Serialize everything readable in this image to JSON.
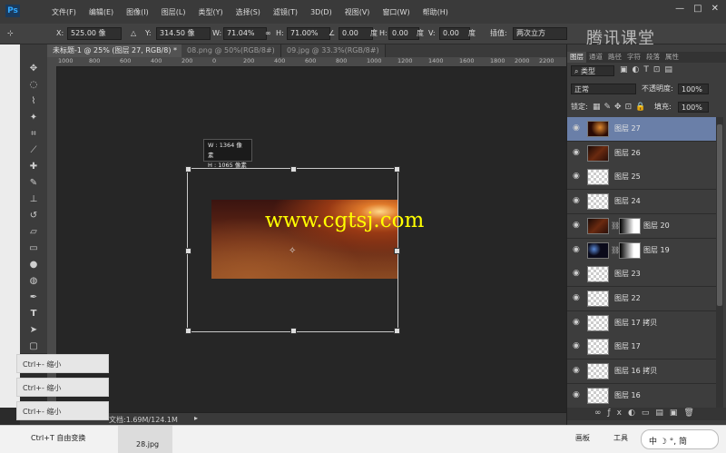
{
  "app": {
    "logo": "Ps"
  },
  "menu": [
    "文件(F)",
    "编辑(E)",
    "图像(I)",
    "图层(L)",
    "类型(Y)",
    "选择(S)",
    "滤镜(T)",
    "3D(D)",
    "视图(V)",
    "窗口(W)",
    "帮助(H)"
  ],
  "window_controls": {
    "minimize": "—",
    "restore": "□",
    "close": "✕"
  },
  "brand": "腾讯课堂",
  "options": {
    "x_label": "X:",
    "x_value": "525.00 像",
    "y_label": "Y:",
    "y_value": "314.50 像",
    "w_label": "W:",
    "w_value": "71.04%",
    "h_label": "H:",
    "h_value": "71.00%",
    "angle_value": "0.00",
    "hskew_label": "H:",
    "hskew_value": "0.00",
    "hskew_unit": "度",
    "vskew_label": "V:",
    "vskew_value": "0.00",
    "vskew_unit": "度",
    "angle_unit": "度",
    "interp_label": "插值:",
    "interp_value": "两次立方"
  },
  "tabs": [
    {
      "label": "未标题-1 @ 25% (图层 27, RGB/8) *",
      "active": true
    },
    {
      "label": "08.png @ 50%(RGB/8#)",
      "active": false
    },
    {
      "label": "09.jpg @ 33.3%(RGB/8#)",
      "active": false
    }
  ],
  "ruler_ticks": [
    "1000",
    "800",
    "600",
    "400",
    "200",
    "0",
    "200",
    "400",
    "600",
    "800",
    "1000",
    "1200",
    "1400",
    "1600",
    "1800",
    "2000",
    "2200"
  ],
  "tooltip": {
    "w": "W : 1364 像素",
    "h": "H : 1065 像素"
  },
  "watermark": "www.cgtsj.com",
  "status": {
    "doc": "文档:1.69M/124.1M"
  },
  "shortcuts": [
    "Ctrl+- 缩小",
    "Ctrl+- 缩小",
    "Ctrl+- 缩小"
  ],
  "taskbar": {
    "free_transform": "Ctrl+T 自由变换",
    "file": "28.jpg",
    "artboard": "画板",
    "tools": "工具",
    "ime": "中 ☽ °, 简"
  },
  "panel": {
    "tabs": [
      "图层",
      "通道",
      "路径",
      "字符",
      "段落",
      "属性"
    ],
    "kind_label": "类型",
    "blend_mode": "正常",
    "opacity_label": "不透明度:",
    "opacity_value": "100%",
    "lock_label": "锁定:",
    "fill_label": "填充:",
    "fill_value": "100%"
  },
  "layers": [
    {
      "name": "图层 27",
      "thumb": "fire",
      "selected": true,
      "mask": false
    },
    {
      "name": "图层 26",
      "thumb": "dark",
      "selected": false,
      "mask": false
    },
    {
      "name": "图层 25",
      "thumb": "trans",
      "selected": false,
      "mask": false
    },
    {
      "name": "图层 24",
      "thumb": "trans",
      "selected": false,
      "mask": false
    },
    {
      "name": "图层 20",
      "thumb": "dark",
      "selected": false,
      "mask": true
    },
    {
      "name": "图层 19",
      "thumb": "space",
      "selected": false,
      "mask": true
    },
    {
      "name": "图层 23",
      "thumb": "trans",
      "selected": false,
      "mask": false
    },
    {
      "name": "图层 22",
      "thumb": "trans",
      "selected": false,
      "mask": false
    },
    {
      "name": "图层 17 拷贝",
      "thumb": "trans",
      "selected": false,
      "mask": false
    },
    {
      "name": "图层 17",
      "thumb": "trans",
      "selected": false,
      "mask": false
    },
    {
      "name": "图层 16 拷贝",
      "thumb": "trans",
      "selected": false,
      "mask": false
    },
    {
      "name": "图层 16",
      "thumb": "trans",
      "selected": false,
      "mask": false
    }
  ]
}
